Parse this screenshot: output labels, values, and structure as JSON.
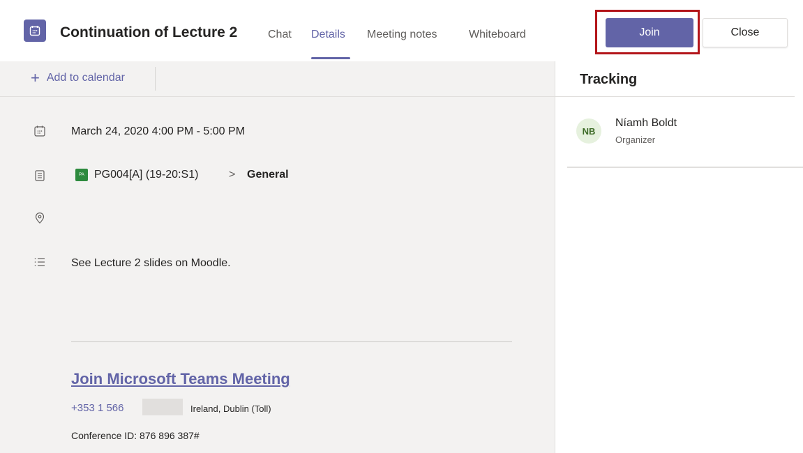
{
  "header": {
    "title": "Continuation of Lecture 2",
    "tabs": [
      {
        "label": "Chat"
      },
      {
        "label": "Details"
      },
      {
        "label": "Meeting notes"
      },
      {
        "label": "Whiteboard"
      }
    ],
    "active_tab": "Details",
    "join_label": "Join",
    "close_label": "Close"
  },
  "toolbar": {
    "add_to_calendar": "Add to calendar"
  },
  "details": {
    "datetime": "March 24, 2020 4:00 PM - 5:00 PM",
    "team_chip": "PA",
    "team_name": "PG004[A] (19-20:S1)",
    "chevron": ">",
    "channel": "General",
    "description": "See Lecture 2 slides on Moodle.",
    "join_link": "Join Microsoft Teams Meeting",
    "phone": "+353 1 566",
    "phone_location": "Ireland, Dublin (Toll)",
    "conference_id": "Conference ID: 876 896 387#"
  },
  "tracking": {
    "title": "Tracking",
    "participants": [
      {
        "initials": "NB",
        "name": "Níamh Boldt",
        "role": "Organizer"
      }
    ]
  },
  "icons": {
    "calendar": "calendar-icon",
    "channel": "channel-icon",
    "location": "location-icon",
    "description": "list-icon",
    "plus": "plus-icon"
  },
  "colors": {
    "accent": "#6264a7",
    "highlight": "#b3151a",
    "team_chip": "#2d8a3e",
    "avatar_bg": "#e6f1de"
  }
}
